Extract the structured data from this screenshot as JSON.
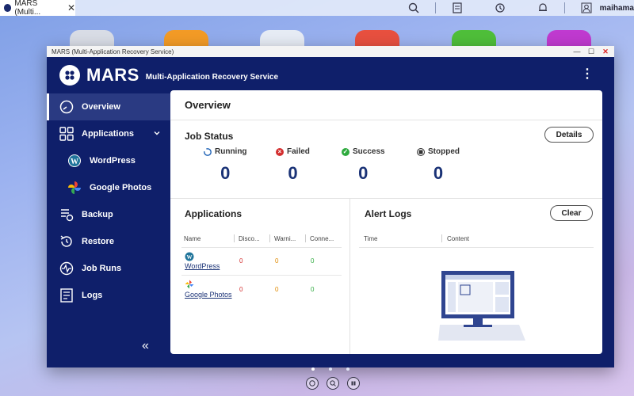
{
  "browser": {
    "tab_title": "MARS (Multi...",
    "close_glyph": "✕",
    "user": "maihama"
  },
  "window": {
    "title": "MARS (Multi-Application Recovery Service)",
    "controls": {
      "minimize": "—",
      "maximize": "☐",
      "close": "✕"
    }
  },
  "header": {
    "app_name": "MARS",
    "subtitle": "Multi-Application Recovery Service",
    "menu_glyph": "⋮"
  },
  "sidebar": {
    "items": [
      {
        "label": "Overview",
        "icon": "gauge-icon",
        "active": true
      },
      {
        "label": "Applications",
        "icon": "grid-icon",
        "expanded": true
      },
      {
        "label": "WordPress",
        "icon": "wordpress-icon",
        "sub": true
      },
      {
        "label": "Google Photos",
        "icon": "google-photos-icon",
        "sub": true
      },
      {
        "label": "Backup",
        "icon": "backup-icon"
      },
      {
        "label": "Restore",
        "icon": "restore-icon"
      },
      {
        "label": "Job Runs",
        "icon": "pulse-icon"
      },
      {
        "label": "Logs",
        "icon": "logs-icon"
      }
    ],
    "collapse_glyph": "«"
  },
  "overview": {
    "title": "Overview",
    "job_status": {
      "title": "Job Status",
      "details_label": "Details",
      "statuses": [
        {
          "label": "Running",
          "value": "0",
          "color": "#1a5fb4"
        },
        {
          "label": "Failed",
          "value": "0",
          "color": "#d32f2f"
        },
        {
          "label": "Success",
          "value": "0",
          "color": "#2eaa3e"
        },
        {
          "label": "Stopped",
          "value": "0",
          "color": "#333333"
        }
      ]
    },
    "applications": {
      "title": "Applications",
      "columns": [
        "Name",
        "Disco...",
        "Warni...",
        "Conne..."
      ],
      "rows": [
        {
          "name": "WordPress",
          "disconnected": "0",
          "warning": "0",
          "connected": "0"
        },
        {
          "name": "Google Photos",
          "disconnected": "0",
          "warning": "0",
          "connected": "0"
        }
      ]
    },
    "alert_logs": {
      "title": "Alert Logs",
      "clear_label": "Clear",
      "columns": [
        "Time",
        "Content"
      ]
    }
  },
  "colors": {
    "window_bg": "#0f1f6a",
    "accent": "#1a3276",
    "disconnected": "#d32f2f",
    "warning": "#e08a00",
    "connected": "#2eaa3e"
  }
}
